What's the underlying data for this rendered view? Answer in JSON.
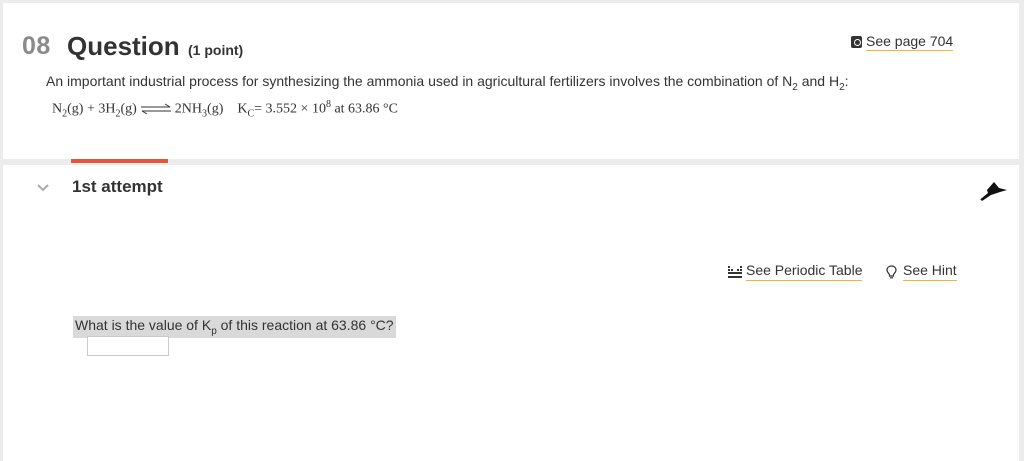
{
  "question": {
    "number": "08",
    "title": "Question",
    "points": "(1 point)",
    "see_page_label": "See page 704",
    "prompt_pre": "An important industrial process for synthesizing the ammonia used in agricultural fertilizers involves the combination of N",
    "prompt_n_sub": "2",
    "prompt_mid": " and H",
    "prompt_h_sub": "2",
    "prompt_post": ":",
    "equation": {
      "reactant1": "N",
      "reactant1_sub": "2",
      "reactant1_state": "(g)",
      "plus": " + 3H",
      "reactant2_sub": "2",
      "reactant2_state": "(g)",
      "product": "2NH",
      "product_sub": "3",
      "product_state": "(g)",
      "kc_label": "K",
      "kc_sub": "C",
      "kc_value": "= 3.552 × 10",
      "kc_exponent": "8",
      "kc_condition": " at 63.86 °C"
    }
  },
  "attempt": {
    "label": "1st attempt",
    "periodic_table_label": "See Periodic Table",
    "hint_label": "See Hint",
    "question_pre": "What is the value of K",
    "question_sub": "p",
    "question_post": " of this reaction at 63.86 °C?",
    "answer_value": ""
  },
  "colors": {
    "accent": "#e4573d",
    "link_underline": "#f0b33c"
  }
}
